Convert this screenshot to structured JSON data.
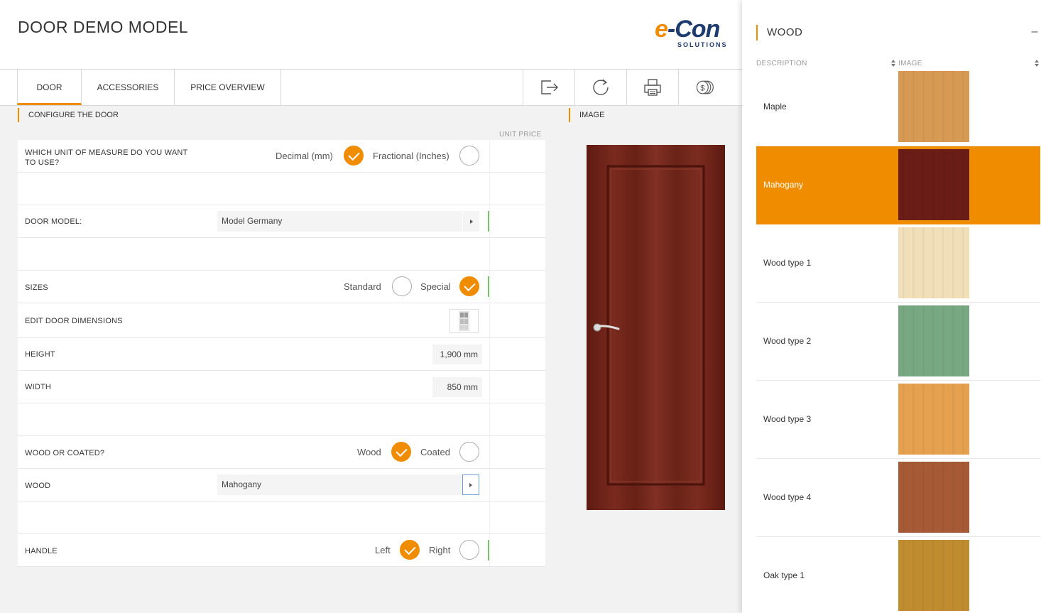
{
  "header": {
    "title": "DOOR DEMO MODEL",
    "logo": {
      "main_e": "e",
      "main_con": "-Con",
      "sub": "SOLUTIONS"
    }
  },
  "tabs": [
    {
      "label": "DOOR",
      "active": true
    },
    {
      "label": "ACCESSORIES",
      "active": false
    },
    {
      "label": "PRICE OVERVIEW",
      "active": false
    }
  ],
  "toolbar": {
    "icons": [
      "exit-icon",
      "refresh-icon",
      "print-icon",
      "coins-icon"
    ]
  },
  "configure": {
    "section_title": "CONFIGURE THE DOOR",
    "unit_price_header": "UNIT PRICE",
    "unit_of_measure": {
      "label": "WHICH UNIT OF MEASURE DO YOU WANT TO USE?",
      "option_decimal": "Decimal (mm)",
      "option_fractional": "Fractional (Inches)",
      "selected": "Decimal (mm)"
    },
    "door_model": {
      "label": "DOOR MODEL:",
      "value": "Model Germany"
    },
    "sizes": {
      "label": "SIZES",
      "option_standard": "Standard",
      "option_special": "Special",
      "selected": "Special"
    },
    "edit_dimensions": {
      "label": "EDIT DOOR DIMENSIONS"
    },
    "height": {
      "label": "HEIGHT",
      "value": "1,900 mm"
    },
    "width": {
      "label": "WIDTH",
      "value": "850 mm"
    },
    "wood_or_coated": {
      "label": "WOOD OR COATED?",
      "option_wood": "Wood",
      "option_coated": "Coated",
      "selected": "Wood"
    },
    "wood": {
      "label": "WOOD",
      "value": "Mahogany"
    },
    "handle": {
      "label": "HANDLE",
      "option_left": "Left",
      "option_right": "Right",
      "selected": "Left"
    }
  },
  "image_section": {
    "title": "IMAGE"
  },
  "wood_panel": {
    "title": "WOOD",
    "collapse_label": "–",
    "col_description": "DESCRIPTION",
    "col_image": "IMAGE",
    "items": [
      {
        "name": "Maple",
        "color": "#d69a55",
        "selected": false
      },
      {
        "name": "Mahogany",
        "color": "#6a1c16",
        "selected": true
      },
      {
        "name": "Wood type 1",
        "color": "#f0dfb8",
        "selected": false
      },
      {
        "name": "Wood type 2",
        "color": "#78a882",
        "selected": false
      },
      {
        "name": "Wood type 3",
        "color": "#e5a050",
        "selected": false
      },
      {
        "name": "Wood type 4",
        "color": "#a65a36",
        "selected": false
      },
      {
        "name": "Oak type 1",
        "color": "#c08c30",
        "selected": false
      }
    ]
  },
  "colors": {
    "accent": "#f08c00",
    "ok_bar": "#7ac36a",
    "door_wood": "#6e2318"
  }
}
